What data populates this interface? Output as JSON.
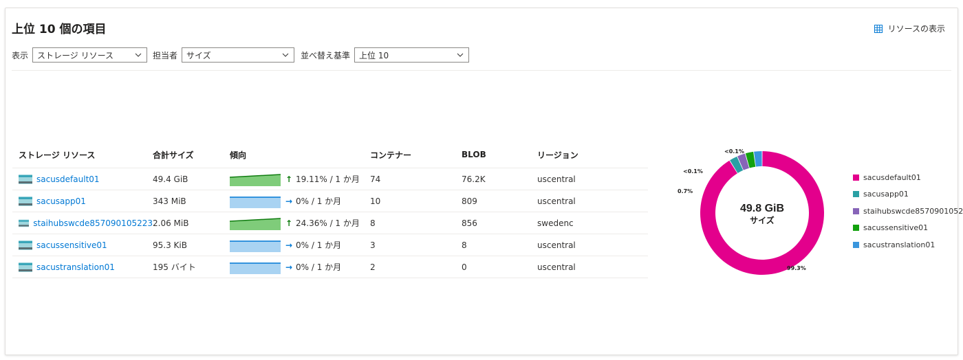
{
  "header": {
    "title": "上位 10 個の項目",
    "view_resources_label": "リソースの表示"
  },
  "filters": {
    "display_label": "表示",
    "display_value": "ストレージ リソース",
    "metric_label": "担当者",
    "metric_value": "サイズ",
    "sort_label": "並べ替え基準",
    "sort_value": "上位 10"
  },
  "table": {
    "columns": [
      "ストレージ リソース",
      "合計サイズ",
      "傾向",
      "コンテナー",
      "BLOB",
      "リージョン"
    ],
    "rows": [
      {
        "name": "sacusdefault01",
        "size": "49.4 GiB",
        "trend_dir": "up",
        "trend": "19.11% / 1 か月",
        "containers": "74",
        "blob": "76.2K",
        "region": "uscentral"
      },
      {
        "name": "sacusapp01",
        "size": "343 MiB",
        "trend_dir": "flat",
        "trend": "0% / 1 か月",
        "containers": "10",
        "blob": "809",
        "region": "uscentral"
      },
      {
        "name": "staihubswcde857090105223",
        "size": "2.06 MiB",
        "trend_dir": "up",
        "trend": "24.36% / 1 か月",
        "containers": "8",
        "blob": "856",
        "region": "swedenc"
      },
      {
        "name": "sacussensitive01",
        "size": "95.3 KiB",
        "trend_dir": "flat",
        "trend": "0% / 1 か月",
        "containers": "3",
        "blob": "8",
        "region": "uscentral"
      },
      {
        "name": "sacustranslation01",
        "size": "195 バイト",
        "trend_dir": "flat",
        "trend": "0% / 1 か月",
        "containers": "2",
        "blob": "0",
        "region": "uscentral"
      }
    ]
  },
  "chart_data": {
    "type": "pie",
    "center_value": "49.8 GiB",
    "center_label": "サイズ",
    "slice_labels": [
      "99.3%",
      "0.7%",
      "<0.1%",
      "<0.1%"
    ],
    "series": [
      {
        "name": "sacusdefault01",
        "value": 91.0,
        "color": "#e3008c"
      },
      {
        "name": "sacusapp01",
        "value": 2.2,
        "color": "#2aa0a4"
      },
      {
        "name": "staihubswcde85709010522",
        "value": 2.2,
        "color": "#8764b8"
      },
      {
        "name": "sacussensitive01",
        "value": 2.2,
        "color": "#13a10e"
      },
      {
        "name": "sacustranslation01",
        "value": 2.2,
        "color": "#3a96dd"
      }
    ]
  },
  "colors": {
    "link": "#0078d4",
    "trend_up_fill": "#7fcc7a",
    "trend_up_line": "#107c10",
    "trend_flat_fill": "#a9d3f2",
    "trend_flat_line": "#0078d4"
  }
}
